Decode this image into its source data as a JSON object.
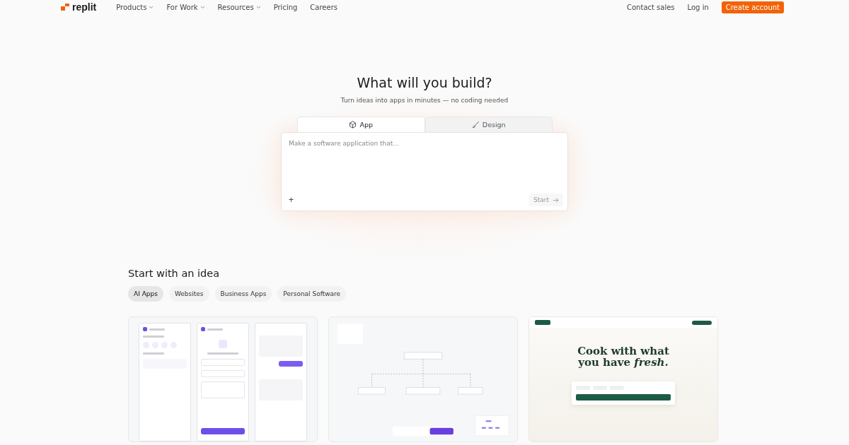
{
  "nav": {
    "logo": "replit",
    "links": [
      {
        "label": "Products",
        "dropdown": true
      },
      {
        "label": "For Work",
        "dropdown": true
      },
      {
        "label": "Resources",
        "dropdown": true
      },
      {
        "label": "Pricing",
        "dropdown": false
      },
      {
        "label": "Careers",
        "dropdown": false
      }
    ],
    "actions": [
      "Contact sales",
      "Log in"
    ],
    "cta": "Create account"
  },
  "hero": {
    "title": "What will you build?",
    "subtitle": "Turn ideas into apps in minutes — no coding needed",
    "tabs": [
      {
        "label": "App",
        "selected": true
      },
      {
        "label": "Design",
        "selected": false
      }
    ],
    "prompt": {
      "placeholder": "Make a software application that..."
    },
    "attach": "+",
    "submit": "Start"
  },
  "ideas": {
    "title": "Start with an idea",
    "categories": [
      {
        "label": "AI Apps",
        "selected": true
      },
      {
        "label": "Websites",
        "selected": false
      },
      {
        "label": "Business Apps",
        "selected": false
      },
      {
        "label": "Personal Software",
        "selected": false
      }
    ],
    "cards": [
      {
        "kind": "chat"
      },
      {
        "kind": "mindmap"
      },
      {
        "kind": "recipe",
        "headline": "Cook with what you have *fresh.*"
      }
    ]
  }
}
